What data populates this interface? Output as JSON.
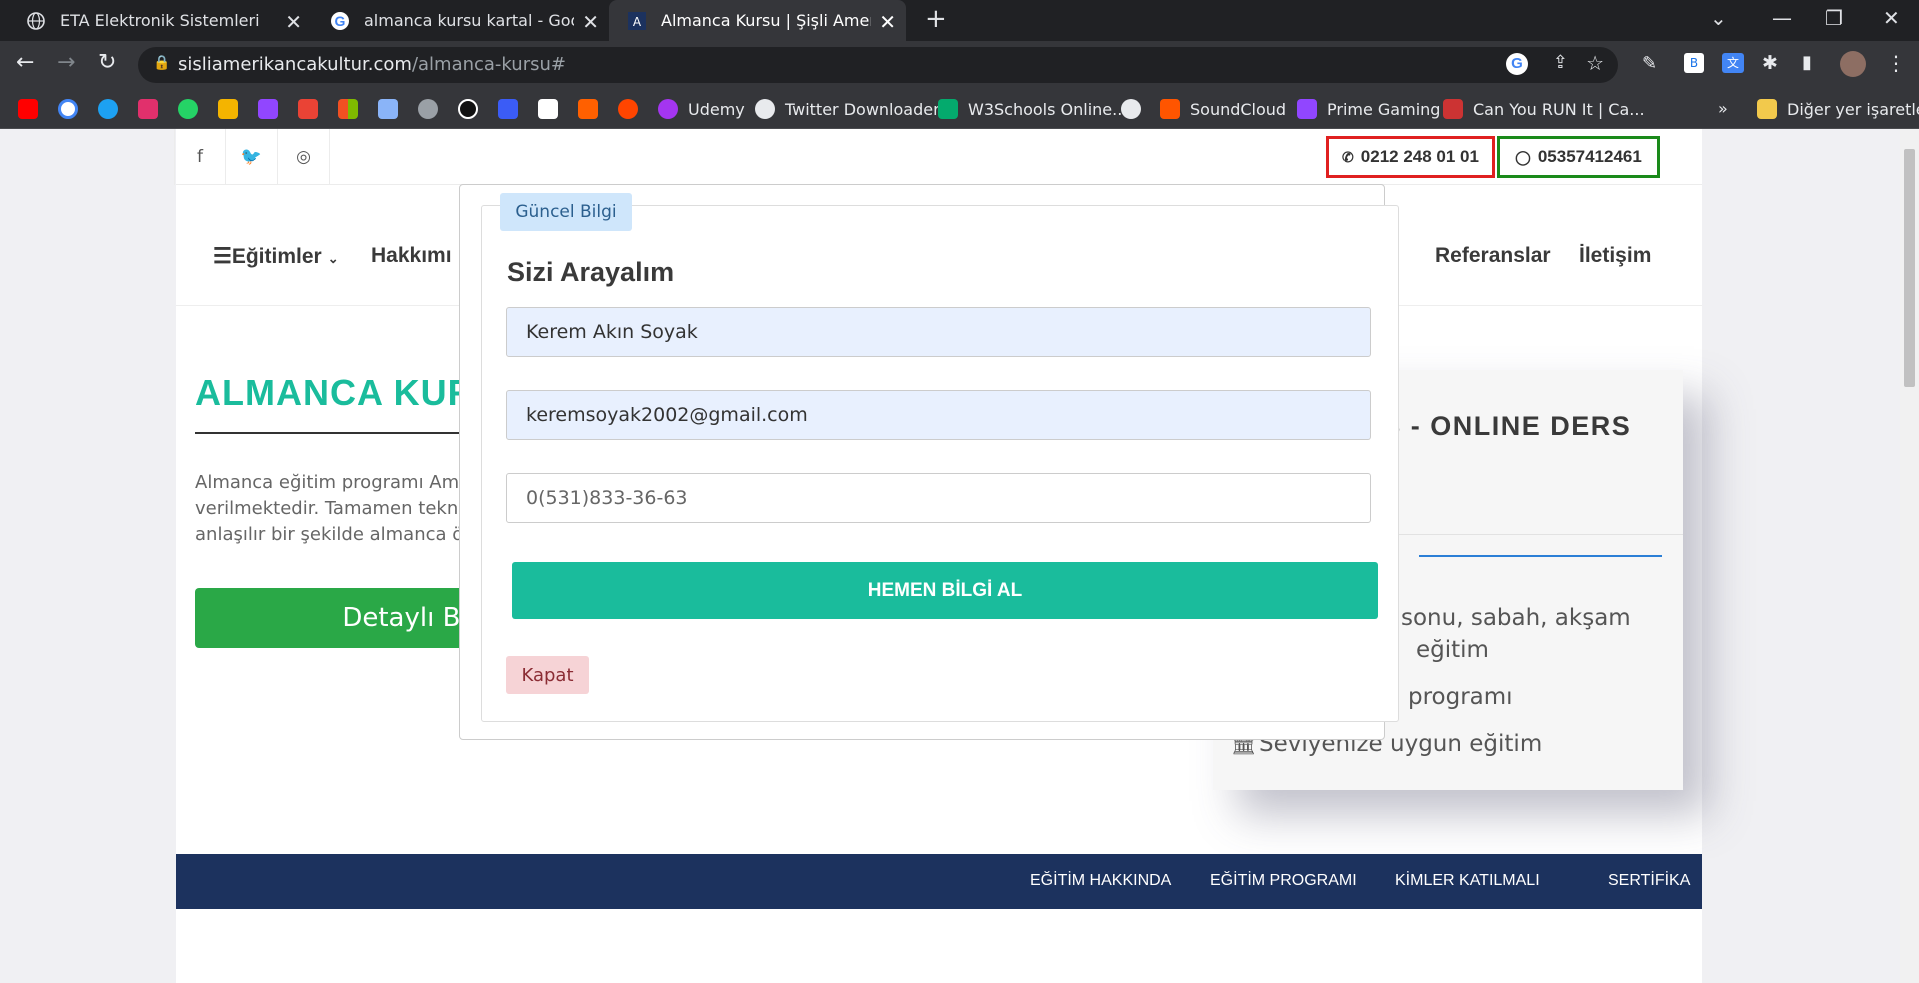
{
  "browser": {
    "tabs": [
      {
        "label": "ETA Elektronik Sistemleri",
        "icon": "globe-icon"
      },
      {
        "label": "almanca kursu kartal - Google'da",
        "icon": "google-icon"
      },
      {
        "label": "Almanca Kursu | Şişli Amerikan Kü",
        "icon": "site-icon"
      }
    ],
    "url_domain": "sisliamerikancakultur.com",
    "url_path": "/almanca-kursu#",
    "bookmarks": [
      {
        "label": "",
        "icon": "youtube-icon",
        "color": "#ff0000"
      },
      {
        "label": "",
        "icon": "google-icon",
        "color": "#4285f4"
      },
      {
        "label": "",
        "icon": "twitter-icon",
        "color": "#1da1f2"
      },
      {
        "label": "",
        "icon": "instagram-icon",
        "color": "#e1306c"
      },
      {
        "label": "",
        "icon": "whatsapp-icon",
        "color": "#25d366"
      },
      {
        "label": "",
        "icon": "camera-icon",
        "color": "#f4b400"
      },
      {
        "label": "",
        "icon": "twitch-icon",
        "color": "#9146ff"
      },
      {
        "label": "",
        "icon": "gmail-icon",
        "color": "#ea4335"
      },
      {
        "label": "",
        "icon": "microsoft-icon",
        "color": "#00a4ef"
      },
      {
        "label": "",
        "icon": "x-icon",
        "color": "#8ab4f8"
      },
      {
        "label": "",
        "icon": "diamond-icon",
        "color": "#9aa0a6"
      },
      {
        "label": "",
        "icon": "arrow-icon",
        "color": "#ffffff"
      },
      {
        "label": "",
        "icon": "flash-icon",
        "color": "#3b5cf6"
      },
      {
        "label": "",
        "icon": "wikipedia-icon",
        "color": "#ffffff"
      },
      {
        "label": "",
        "icon": "hb-icon",
        "color": "#ff6000"
      },
      {
        "label": "",
        "icon": "reddit-icon",
        "color": "#ff4500"
      },
      {
        "label": "Udemy",
        "icon": "udemy-icon",
        "color": "#a435f0"
      },
      {
        "label": "Twitter Downloader",
        "icon": "globe-icon",
        "color": "#e8eaed"
      },
      {
        "label": "W3Schools Online...",
        "icon": "w3schools-icon",
        "color": "#04aa6d"
      },
      {
        "label": "",
        "icon": "globe-icon",
        "color": "#e8eaed"
      },
      {
        "label": "SoundCloud",
        "icon": "soundcloud-icon",
        "color": "#ff5500"
      },
      {
        "label": "Prime Gaming",
        "icon": "crown-icon",
        "color": "#9146ff"
      },
      {
        "label": "Can You RUN It | Ca...",
        "icon": "canyourunit-icon",
        "color": "#cc3333"
      }
    ],
    "other_bookmarks": "Diğer yer işaretleri"
  },
  "site": {
    "phone": "0212 248 01 01",
    "whatsapp": "05357412461",
    "nav": {
      "egitimler": "Eğitimler",
      "hakkimizda": "Hakkımı",
      "referanslar": "Referanslar",
      "iletisim": "İletişim"
    },
    "heading": "ALMANCA KURS",
    "paragraph": [
      "Almanca eğitim programı Ame",
      "verilmektedir. Tamamen tekno",
      "anlaşılır bir şekilde almanca öğ"
    ],
    "detail_button": "Detaylı Bi",
    "side_title": "DERS - ONLINE DERS",
    "side_features": [
      "sonu, sabah, akşam",
      "eğitim",
      "programı",
      "Seviyenize uygun eğitim"
    ],
    "footer_links": [
      "EĞİTİM HAKKINDA",
      "EĞİTİM PROGRAMI",
      "KİMLER KATILMALI",
      "SERTİFİKA"
    ]
  },
  "modal": {
    "badge": "Güncel Bilgi",
    "title": "Sizi Arayalım",
    "name_value": "Kerem Akın Soyak",
    "email_value": "keremsoyak2002@gmail.com",
    "phone_value": "0(531)833-36-63",
    "submit": "HEMEN BİLGİ AL",
    "close": "Kapat"
  },
  "colors": {
    "accent": "#1abc9c",
    "detail_green": "#2aa847",
    "footer_navy": "#1c325e",
    "phone_border": "#e02020",
    "whatsapp_border": "#1a8a1a"
  }
}
